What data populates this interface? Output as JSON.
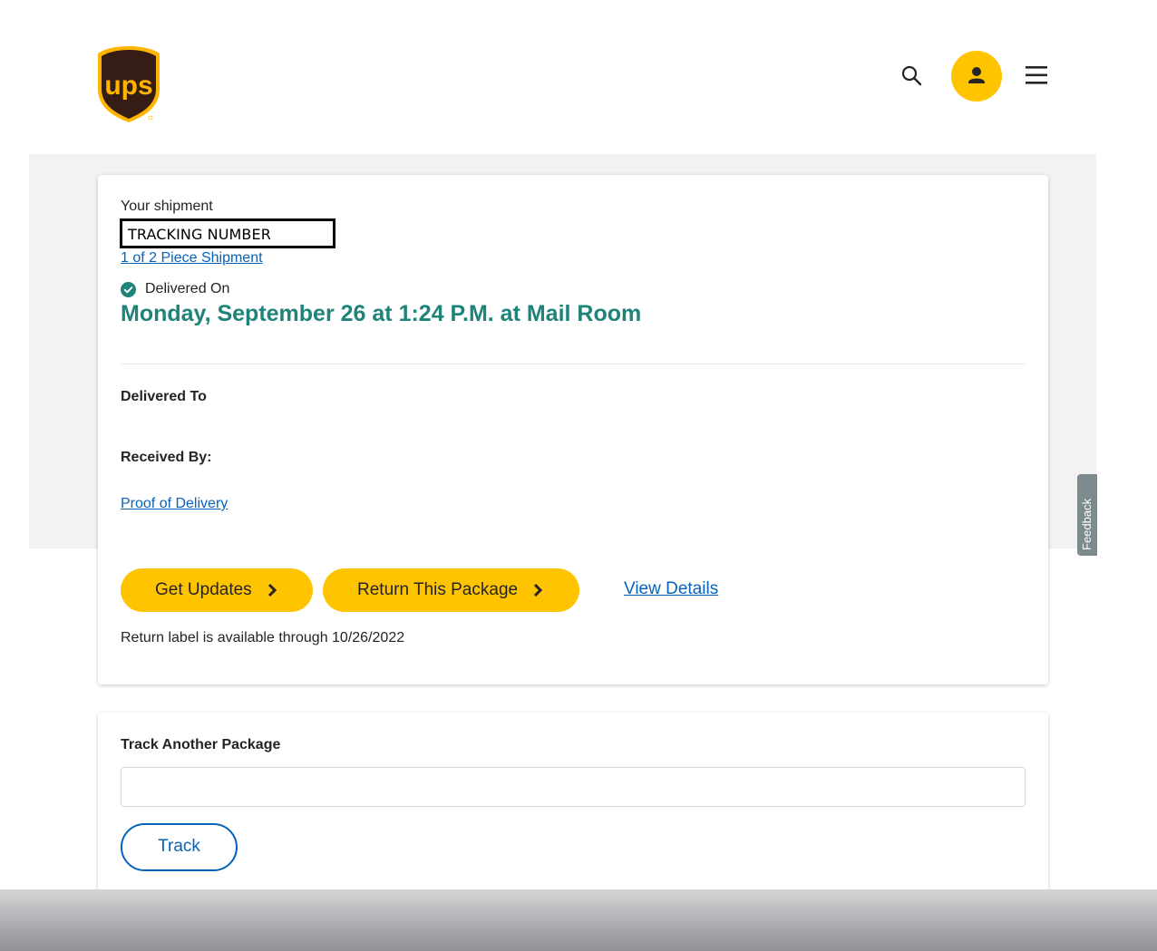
{
  "header": {
    "logo_text": "ups",
    "icons": {
      "search": "search-icon",
      "account": "user-icon",
      "menu": "hamburger-menu-icon"
    }
  },
  "shipment": {
    "label": "Your shipment",
    "tracking_number": "TRACKING NUMBER",
    "piece_link": "1 of 2 Piece Shipment",
    "status_label": "Delivered On",
    "delivery_datetime": "Monday, September 26 at 1:24 P.M. at Mail Room",
    "delivered_to_label": "Delivered To",
    "received_by_label": "Received By:",
    "proof_link": "Proof of Delivery",
    "get_updates_label": "Get Updates",
    "return_package_label": "Return This Package",
    "view_details_label": "View Details",
    "return_note": "Return label is available through 10/26/2022"
  },
  "track_another": {
    "heading": "Track Another Package",
    "input_value": "",
    "track_button": "Track"
  },
  "feedback_tab": "Feedback",
  "colors": {
    "brand_yellow": "#ffc400",
    "brand_brown": "#351c15",
    "success_teal": "#1e8479",
    "link_blue": "#0662bb"
  }
}
